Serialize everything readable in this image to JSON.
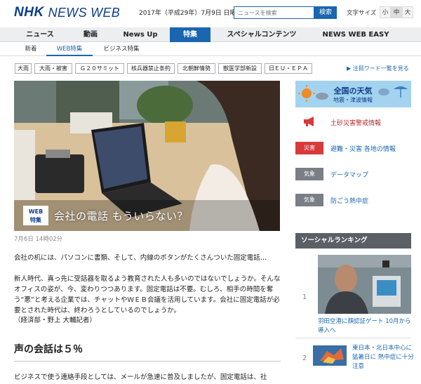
{
  "header": {
    "logo_nhk": "NHK",
    "logo_newsweb": "NEWS WEB",
    "date": "2017年（平成29年）7月9日 日曜日",
    "search_placeholder": "ニュースを検索",
    "search_button": "検索",
    "font_size_label": "文字サイズ",
    "font_sizes": [
      "小",
      "中",
      "大"
    ],
    "font_size_selected": "中"
  },
  "nav": {
    "items": [
      "ニュース",
      "動画",
      "News Up",
      "特集",
      "スペシャルコンテンツ",
      "NEWS WEB EASY"
    ],
    "active": "特集"
  },
  "subnav": {
    "items": [
      "新着",
      "WEB特集",
      "ビジネス特集"
    ],
    "active": "WEB特集"
  },
  "tags": [
    "大雨",
    "大雨・被害",
    "Ｇ２０サミット",
    "核兵器禁止条約",
    "北朝鮮情勢",
    "獣医学部新設",
    "日ＥＵ・ＥＰＡ"
  ],
  "tag_more": "▶ 注目ワード一覧を見る",
  "article": {
    "web_tag_line1": "WEB",
    "web_tag_line2": "特集",
    "headline": "会社の電話 もういらない？",
    "timestamp": "7月6日 14時02分",
    "lead": "会社の机には、パソコンに書類、そして、内線のボタンがたくさんついた固定電話…",
    "body": "新人時代、真っ先に受話器を取るよう教育された人も多いのではないでしょうか。そんなオフィスの姿が、今、変わりつつあります。固定電話は不要。むしろ、相手の時間を奪う“悪”と考える企業では、チャットやＷＥＢ会議を活用しています。会社に固定電話が必要とされた時代は、終わろうとしているのでしょうか。",
    "byline": "（経済部・野上 大輔記者）",
    "section_heading": "声の会話は５％",
    "section_text": "ビジネスで使う連絡手段としては、メールが急速に普及しましたが、固定電話は、社"
  },
  "sidebar": {
    "weather_title": "全国の天気",
    "weather_sub": "地震・津波情報",
    "alerts": [
      {
        "badge": "",
        "text": "土砂災害警戒情報",
        "style": "megaphone"
      },
      {
        "badge": "災害",
        "text": "避難・災害 各地の情報",
        "style": "red"
      },
      {
        "badge": "気象",
        "text": "データマップ",
        "style": "gray"
      },
      {
        "badge": "気象",
        "text": "防ごう熱中症",
        "style": "gray"
      }
    ],
    "social_heading": "ソーシャルランキング",
    "ranking": [
      {
        "rank": "1",
        "text": "羽田空港に顔認証ゲート 10月から導入へ"
      },
      {
        "rank": "2",
        "text": "東日本・北日本中心に猛暑日に 熱中症に十分注意"
      }
    ]
  },
  "colors": {
    "brand": "#0e3d8a",
    "accent": "#1a66b0",
    "alert_red": "#d9393b",
    "badge_gray": "#7a7f86"
  }
}
